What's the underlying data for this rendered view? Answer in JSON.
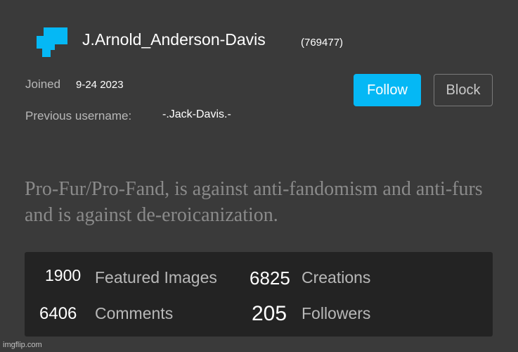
{
  "profile": {
    "avatar_icon": "pixel-avatar-icon",
    "avatar_color": "#05b8f5",
    "username": "J.Arnold_Anderson-Davis",
    "user_id": "(769477)",
    "joined_label": "Joined",
    "joined_date": "9-24 2023",
    "previous_username_label": "Previous username:",
    "previous_username": "-.Jack-Davis.-",
    "bio": "Pro-Fur/Pro-Fand, is against anti-fandomism and anti-furs and is against de-eroicanization."
  },
  "actions": {
    "follow_label": "Follow",
    "block_label": "Block",
    "follow_color": "#05b8f5"
  },
  "stats": {
    "featured_images": {
      "value": "1900",
      "label": "Featured Images"
    },
    "creations": {
      "value": "6825",
      "label": "Creations"
    },
    "comments": {
      "value": "6406",
      "label": "Comments"
    },
    "followers": {
      "value": "205",
      "label": "Followers"
    }
  },
  "watermark": "imgflip.com"
}
